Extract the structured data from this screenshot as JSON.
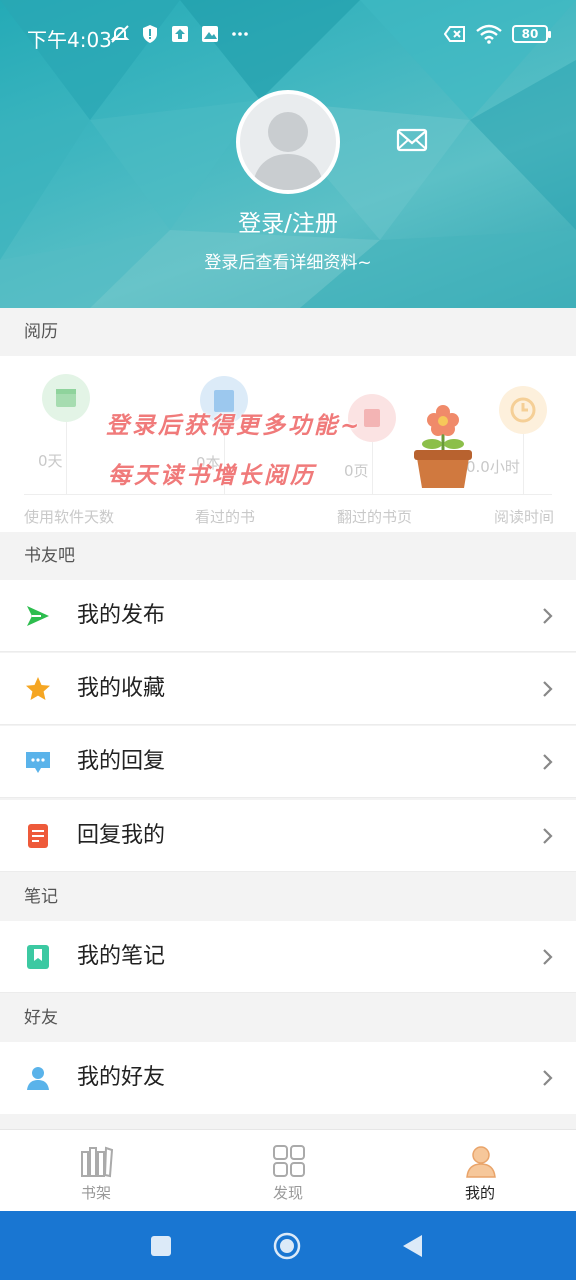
{
  "status_bar": {
    "time": "下午4:03",
    "battery": "80",
    "icons_left": [
      "mute-icon",
      "shield-icon",
      "upload-icon",
      "image-icon",
      "more-dots-icon"
    ],
    "icons_right": [
      "sim-off-icon",
      "wifi-icon",
      "battery-icon"
    ]
  },
  "profile": {
    "login_title": "登录/注册",
    "login_subtitle": "登录后查看详细资料~"
  },
  "sections": {
    "history": "阅历",
    "book_friends": "书友吧",
    "notes": "笔记",
    "friends": "好友"
  },
  "history": {
    "stats": [
      {
        "value": "0天",
        "label": "使用软件天数",
        "color": "#8fd39c"
      },
      {
        "value": "0本",
        "label": "看过的书",
        "color": "#7cb6e6"
      },
      {
        "value": "0页",
        "label": "翻过的书页",
        "color": "#f2a6a6"
      },
      {
        "value": "0.0小时",
        "label": "阅读时间",
        "color": "#f5cf96"
      }
    ],
    "overlay_line1": "登录后获得更多功能~",
    "overlay_line2": "每天读书增长阅历"
  },
  "book_friends_rows": [
    {
      "label": "我的发布",
      "icon": "send-icon"
    },
    {
      "label": "我的收藏",
      "icon": "star-icon"
    },
    {
      "label": "我的回复",
      "icon": "chat-bubble-icon"
    },
    {
      "label": "回复我的",
      "icon": "document-icon"
    }
  ],
  "notes_rows": [
    {
      "label": "我的笔记",
      "icon": "bookmark-note-icon"
    }
  ],
  "friends_rows": [
    {
      "label": "我的好友",
      "icon": "person-icon"
    }
  ],
  "bottom_nav": [
    {
      "label": "书架",
      "icon": "bookshelf-icon",
      "active": false
    },
    {
      "label": "发现",
      "icon": "grid-icon",
      "active": false
    },
    {
      "label": "我的",
      "icon": "profile-icon",
      "active": true
    }
  ],
  "colors": {
    "header_teal": "#2fb0bb",
    "system_bar": "#1976d2",
    "send_green": "#2dbd4e",
    "star_orange": "#f5a623",
    "chat_blue": "#5ab3ea",
    "doc_red": "#ee5a3a",
    "note_teal": "#3cc9a2",
    "person_blue": "#5ab3ea"
  }
}
